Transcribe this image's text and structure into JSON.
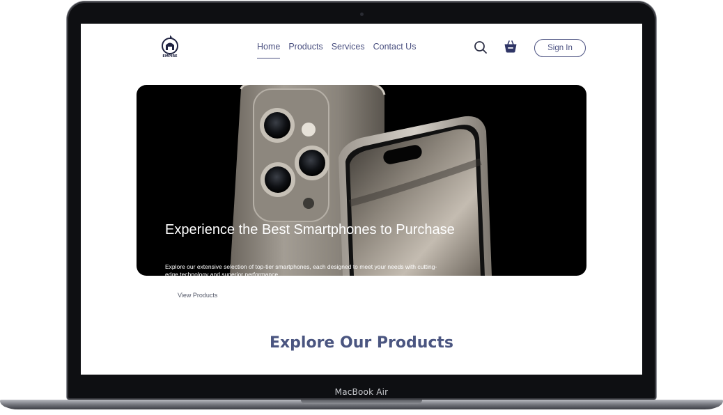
{
  "device": {
    "label": "MacBook Air"
  },
  "header": {
    "logo_text": "EMPIRE",
    "nav": [
      {
        "label": "Home",
        "active": true
      },
      {
        "label": "Products",
        "active": false
      },
      {
        "label": "Services",
        "active": false
      },
      {
        "label": "Contact Us",
        "active": false
      }
    ],
    "search_icon": "search-icon",
    "cart_icon": "basket-icon",
    "signin_label": "Sign In"
  },
  "hero": {
    "title": "Experience the Best Smartphones to Purchase",
    "description": "Explore our extensive selection of top-tier smartphones, each designed to meet your needs with cutting-edge technology and superior performance.",
    "cta_label": "View Products"
  },
  "products": {
    "section_title": "Explore Our Products"
  },
  "colors": {
    "brand": "#4a5580",
    "hero_bg": "#000000",
    "page_bg": "#ffffff"
  }
}
